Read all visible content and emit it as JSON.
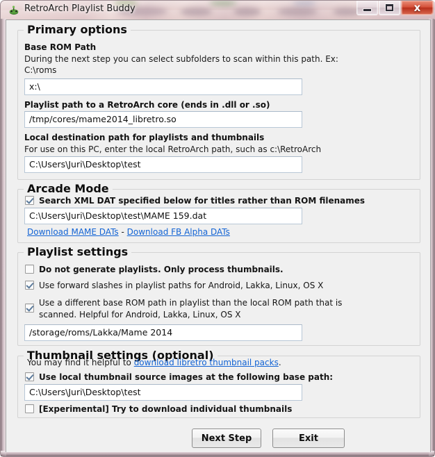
{
  "window": {
    "title": "RetroArch Playlist Buddy",
    "icon": "app-icon",
    "controls": {
      "minimize": "minimize-icon",
      "maximize": "maximize-icon",
      "close": "x"
    }
  },
  "primary": {
    "group_title": "Primary options",
    "base_rom_label": "Base ROM Path",
    "base_rom_hint": "During the next step you can select subfolders to scan within this path. Ex:",
    "base_rom_hint2": "C:\\roms",
    "base_rom_value": "x:\\",
    "core_label": "Playlist path to a RetroArch core (ends in .dll or .so)",
    "core_value": "/tmp/cores/mame2014_libretro.so",
    "dest_label": "Local destination path for playlists and thumbnails",
    "dest_hint": "For use on this PC, enter the local RetroArch path, such as c:\\RetroArch",
    "dest_value": "C:\\Users\\Juri\\Desktop\\test"
  },
  "arcade": {
    "group_title": "Arcade Mode",
    "xml_dat_checkbox": "Search XML DAT specified below for titles rather than ROM filenames",
    "xml_dat_checked": true,
    "dat_value": "C:\\Users\\Juri\\Desktop\\test\\MAME 159.dat",
    "link_mame": "Download MAME DATs",
    "link_separator": " - ",
    "link_fbalpha": "Download FB Alpha DATs"
  },
  "playlist": {
    "group_title": "Playlist settings",
    "opt1": "Do not generate playlists. Only process thumbnails.",
    "opt1_checked": false,
    "opt2": "Use forward slashes in playlist paths for Android, Lakka, Linux, OS X",
    "opt2_checked": true,
    "opt3_line1": "Use a different base ROM path in playlist than the local ROM path that is",
    "opt3_line2": "scanned. Helpful for Android, Lakka, Linux, OS X",
    "opt3_checked": true,
    "alt_path_value": "/storage/roms/Lakka/Mame 2014"
  },
  "thumbnail": {
    "group_title": "Thumbnail settings (optional)",
    "hint_prefix": "You may find it helpful to ",
    "hint_link": "download libretro thumbnail packs",
    "hint_suffix": ".",
    "opt1": "Use local thumbnail source images at the following base path:",
    "opt1_checked": true,
    "base_path_value": "C:\\Users\\Juri\\Desktop\\test",
    "opt2": "[Experimental] Try to download individual thumbnails",
    "opt2_checked": false
  },
  "footer": {
    "next_label": "Next Step",
    "exit_label": "Exit"
  },
  "colors": {
    "link": "#1263d4",
    "group_border": "#d3d3d3",
    "input_border": "#b8c7d6",
    "client_bg": "#f0f0f0",
    "close_button": "#c03a22"
  }
}
